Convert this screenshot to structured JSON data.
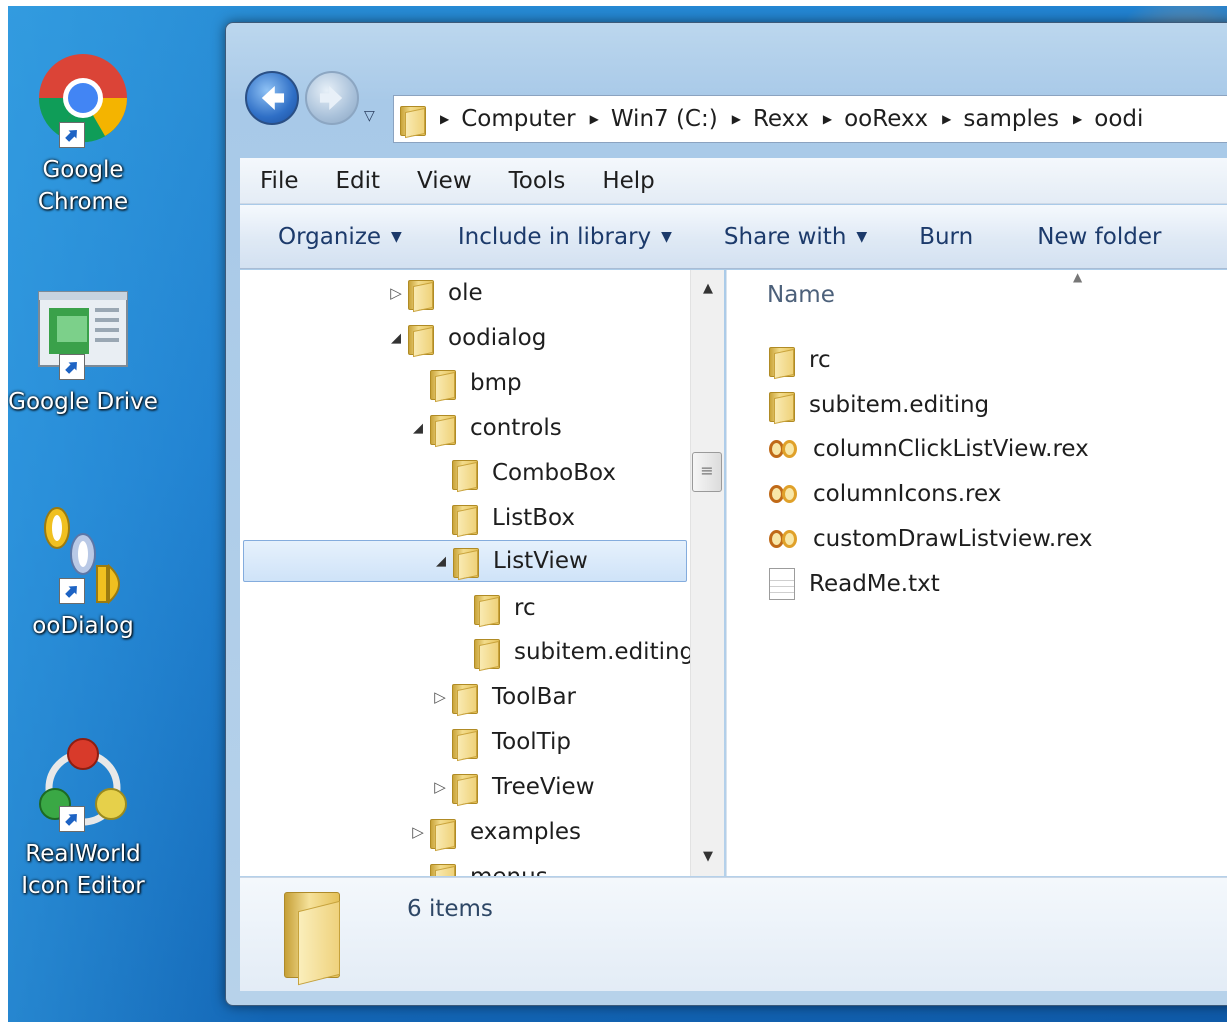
{
  "desktop": {
    "icons": [
      {
        "label_line1": "Google",
        "label_line2": "Chrome"
      },
      {
        "label_line1": "Google Drive",
        "label_line2": ""
      },
      {
        "label_line1": "ooDialog",
        "label_line2": ""
      },
      {
        "label_line1": "RealWorld",
        "label_line2": "Icon Editor"
      }
    ]
  },
  "address_bar": {
    "breadcrumbs": [
      "Computer",
      "Win7 (C:)",
      "Rexx",
      "ooRexx",
      "samples",
      "oodi"
    ]
  },
  "menu": {
    "items": [
      "File",
      "Edit",
      "View",
      "Tools",
      "Help"
    ]
  },
  "toolbar": {
    "organize": "Organize",
    "include_in_library": "Include in library",
    "share_with": "Share with",
    "burn": "Burn",
    "new_folder": "New folder"
  },
  "tree": {
    "items": [
      {
        "label": "ole",
        "expander": "▷"
      },
      {
        "label": "oodialog",
        "expander": "◢"
      },
      {
        "label": "bmp",
        "expander": ""
      },
      {
        "label": "controls",
        "expander": "◢"
      },
      {
        "label": "ComboBox",
        "expander": ""
      },
      {
        "label": "ListBox",
        "expander": ""
      },
      {
        "label": "ListView",
        "expander": "◢"
      },
      {
        "label": "rc",
        "expander": ""
      },
      {
        "label": "subitem.editing",
        "expander": ""
      },
      {
        "label": "ToolBar",
        "expander": "▷"
      },
      {
        "label": "ToolTip",
        "expander": ""
      },
      {
        "label": "TreeView",
        "expander": "▷"
      },
      {
        "label": "examples",
        "expander": "▷"
      },
      {
        "label": "menus",
        "expander": ""
      }
    ],
    "selected": "ListView"
  },
  "content": {
    "column_header": "Name",
    "files": [
      {
        "name": "rc",
        "icon": "folder-icon"
      },
      {
        "name": "subitem.editing",
        "icon": "folder-icon"
      },
      {
        "name": "columnClickListView.rex",
        "icon": "rex-file-icon"
      },
      {
        "name": "columnIcons.rex",
        "icon": "rex-file-icon"
      },
      {
        "name": "customDrawListview.rex",
        "icon": "rex-file-icon"
      },
      {
        "name": "ReadMe.txt",
        "icon": "text-file-icon"
      }
    ]
  },
  "details": {
    "item_count": "6 items"
  },
  "colors": {
    "desktop_blue": "#1f7fcf",
    "selection_blue": "#cfe3f8",
    "toolbar_text": "#1c3a6b"
  }
}
